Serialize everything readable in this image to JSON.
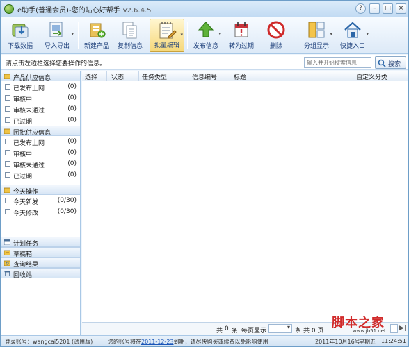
{
  "window": {
    "title": "e助手(普通会员)-您的贴心好帮手",
    "version": "v2.6.4.5"
  },
  "titlebar_buttons": {
    "help": "?",
    "minimize": "–",
    "maximize": "□",
    "close": "×"
  },
  "toolbar": [
    {
      "id": "download",
      "label": "下载数据",
      "icon": "download-icon"
    },
    {
      "id": "import-export",
      "label": "导入导出",
      "icon": "import-export-icon",
      "has_menu": true
    },
    {
      "id": "new-product",
      "label": "新建产品",
      "icon": "new-product-icon"
    },
    {
      "id": "copy-info",
      "label": "复制信息",
      "icon": "copy-icon"
    },
    {
      "id": "batch-edit",
      "label": "批量编辑",
      "icon": "batch-edit-icon",
      "has_menu": true,
      "active": true
    },
    {
      "id": "publish",
      "label": "发布信息",
      "icon": "publish-icon",
      "has_menu": true
    },
    {
      "id": "to-expired",
      "label": "转为过期",
      "icon": "expire-icon"
    },
    {
      "id": "delete",
      "label": "删除",
      "icon": "delete-icon"
    },
    {
      "id": "group-view",
      "label": "分组显示",
      "icon": "group-icon",
      "has_menu": true
    },
    {
      "id": "quick-entry",
      "label": "快捷入口",
      "icon": "home-icon",
      "has_menu": true
    }
  ],
  "infobar": {
    "hint": "请点击左边栏选择您要操作的信息。",
    "search_placeholder": "输入并开始搜索信息",
    "search_button": "搜索"
  },
  "sidebar": {
    "groups": [
      {
        "title": "产品供应信息",
        "items": [
          {
            "label": "已发布上网",
            "count": "(0)"
          },
          {
            "label": "审核中",
            "count": "(0)"
          },
          {
            "label": "审核未通过",
            "count": "(0)"
          },
          {
            "label": "已过期",
            "count": "(0)"
          }
        ]
      },
      {
        "title": "团批供应信息",
        "items": [
          {
            "label": "已发布上网",
            "count": "(0)"
          },
          {
            "label": "审核中",
            "count": "(0)"
          },
          {
            "label": "审核未通过",
            "count": "(0)"
          },
          {
            "label": "已过期",
            "count": "(0)"
          }
        ]
      },
      {
        "title": "今天操作",
        "items": [
          {
            "label": "今天新发",
            "count": "(0/30)"
          },
          {
            "label": "今天修改",
            "count": "(0/30)"
          }
        ]
      }
    ],
    "sections": [
      "计划任务",
      "草稿箱",
      "查询结果",
      "回收站"
    ]
  },
  "list": {
    "columns": [
      "选择",
      "状态",
      "任务类型",
      "信息编号",
      "标题",
      "自定义分类"
    ]
  },
  "pager": {
    "total_prefix": "共",
    "total_count": "0",
    "total_suffix": "条",
    "per_page_label": "每页显示",
    "per_page_value": "",
    "per_page_unit": "条",
    "pages_text": "共 0 页"
  },
  "watermark": {
    "brand": "脚本之家",
    "url": "www.jb51.net"
  },
  "statusbar": {
    "account_label": "登录账号：",
    "account": "wangcai5201",
    "account_type": "(试用版)",
    "expire_prefix": "您的账号将在",
    "expire_date": "2011-12-23",
    "expire_suffix": "到期，请尽快购买或续费以免影响使用",
    "date": "2011年10月16号",
    "weekday": "星期五",
    "time": "11:24:51"
  },
  "colors": {
    "title_gradient": "#c2dbf3",
    "toolbar_text": "#1d3f7a",
    "active_tool": "#f6d87a",
    "link": "#1a55b8",
    "watermark": "#d12b2b"
  }
}
